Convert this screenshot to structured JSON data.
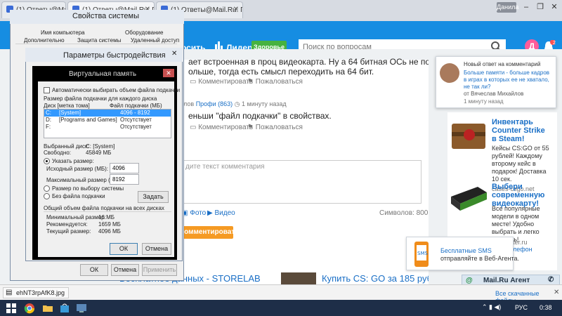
{
  "browser": {
    "tabs": [
      {
        "label": "(1) Ответы@Mail.Ru: Что"
      },
      {
        "label": "(1) Ответы@Mail.Ru: Про"
      },
      {
        "label": "(1) Ответы@Mail.Ru: Про"
      }
    ],
    "user": "Данила"
  },
  "site": {
    "nav_ask": "осить",
    "nav_leaders": "Лидеры",
    "badge_green": "Здоровье",
    "search_placeholder": "Поиск по вопросам",
    "avatar_letter": "Д",
    "bell_count": "2"
  },
  "answers": [
    {
      "line1": "ает встроенная в проц видеокарта. Ну а 64 битная ОСь не поможет. Нужно",
      "line2": "ольше, тогда есть смысл переходить на 64 бит."
    },
    {
      "meta_prefix": "злов",
      "meta_level": "Профи (863)",
      "meta_time": "1 минуту назад",
      "line1": "еньши \"файл подкачки\" в свойствах."
    }
  ],
  "actions": {
    "comment": "Комментировать",
    "report": "Пожаловаться"
  },
  "comment_form": {
    "placeholder": "дите текст комментария",
    "photo": "Фото",
    "video": "Видео",
    "chars": "Символов: 800",
    "submit": "Комментировать"
  },
  "bottom_links": {
    "left": "Бесплатное данных - STORELAB",
    "right": "Купить CS: GO за 185 рублей"
  },
  "notification": {
    "title": "Новый ответ на комментарий",
    "l1": "Больше памяти - больше кадров",
    "l2": "в играх в которых ее не хватало,",
    "l3": "не так ли?",
    "author": "от Вячеслав Михайлов",
    "time": "1 минуту назад"
  },
  "ads": [
    {
      "title1": "Инвентарь",
      "title2": "Counter Strike",
      "title3": "в Steam!",
      "text": [
        "Кейсы CS:GO от 55",
        "рублей! Каждому",
        "второму кейс в",
        "подарок! Доставка",
        "10 сек."
      ],
      "url": "cases-csgo.net"
    },
    {
      "title1": "Выбери",
      "title2": "современную",
      "title3": "видеокарту!",
      "text": [
        "Все популярные",
        "модели в одном",
        "месте! Удобно",
        "выбрать и легко",
        "заказать!"
      ],
      "url1": "ter.ru",
      "url2": "лефон"
    }
  ],
  "agent": {
    "promo_title": "Бесплатные SMS",
    "promo_text": "отправляйте в Веб-Агента.",
    "bar_label": "Mail.Ru Агент"
  },
  "download": {
    "filename": "ehNT3rpAfK8.jpg",
    "all_link": "Все скачанные файлы..."
  },
  "taskbar": {
    "lang": "РУС",
    "time": "0:38"
  },
  "sysprops": {
    "title": "Свойства системы",
    "tabs_row1": [
      "Имя компьютера",
      "Оборудование"
    ],
    "tabs_row2": [
      "Дополнительно",
      "Защита системы",
      "Удаленный доступ"
    ],
    "ok": "ОК",
    "cancel": "Отмена",
    "apply": "Применить"
  },
  "perf": {
    "title": "Параметры быстродействия"
  },
  "vmem": {
    "title": "Виртуальная память",
    "auto_label": "Автоматически выбирать объем файла подкачки",
    "group_label": "Размер файла подкачки для каждого диска",
    "col_disk": "Диск [метка тома]",
    "col_size": "Файл подкачки (МБ)",
    "drives": [
      {
        "disk": "C:",
        "label": "[System]",
        "size": "4096 - 8192"
      },
      {
        "disk": "D:",
        "label": "[Programs and Games]",
        "size": "Отсутствует"
      },
      {
        "disk": "F:",
        "label": "",
        "size": "Отсутствует"
      }
    ],
    "selected_disk_label": "Выбранный диск:",
    "selected_disk_value": "C:  [System]",
    "free_label": "Свободно:",
    "free_value": "45849 МБ",
    "radio_custom": "Указать размер:",
    "initial_label": "Исходный размер (МБ):",
    "initial_value": "4096",
    "max_label": "Максимальный размер (МБ):",
    "max_value": "8192",
    "radio_system": "Размер по выбору системы",
    "radio_none": "Без файла подкачки",
    "set_button": "Задать",
    "total_header": "Общий объем файла подкачки на всех дисках",
    "min_label": "Минимальный размер:",
    "min_value": "16 МБ",
    "rec_label": "Рекомендуется:",
    "rec_value": "1659 МБ",
    "cur_label": "Текущий размер:",
    "cur_value": "4096 МБ",
    "ok": "ОК",
    "cancel": "Отмена"
  }
}
